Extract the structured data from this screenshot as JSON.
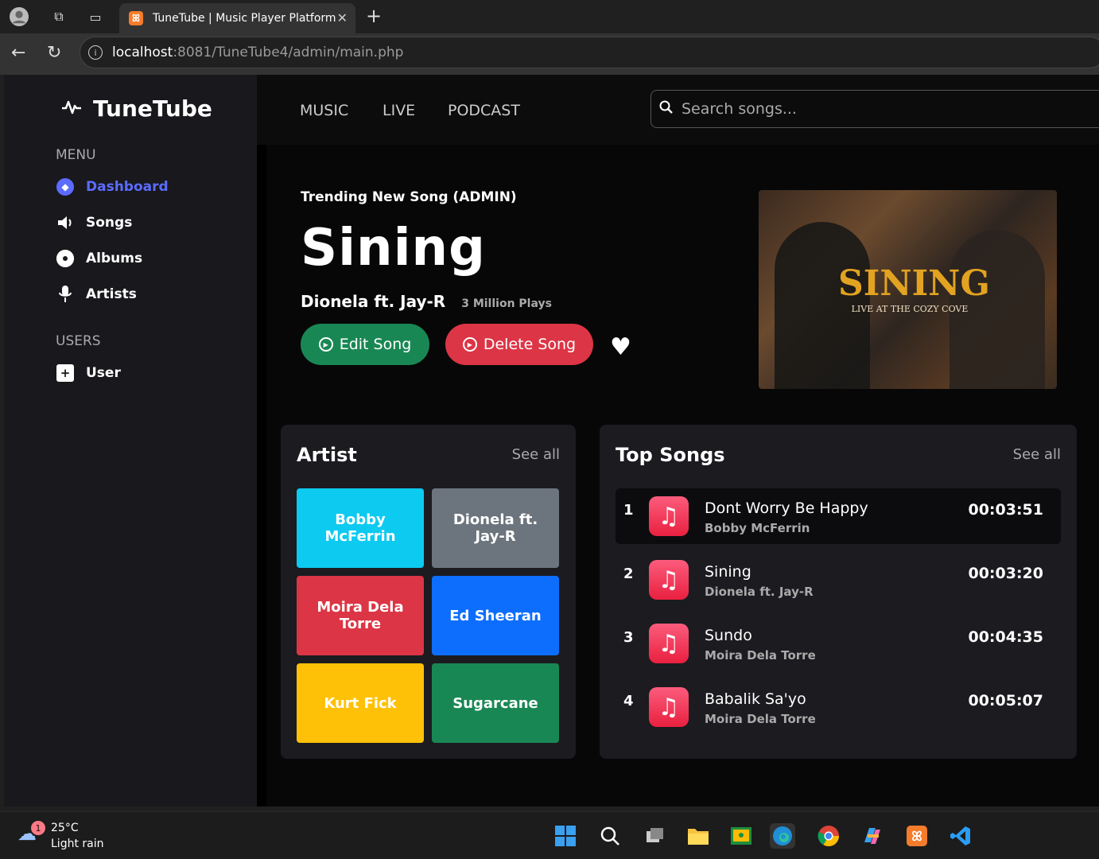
{
  "browser": {
    "tab_title": "TuneTube | Music Player Platform",
    "url_host": "localhost",
    "url_rest": ":8081/TuneTube4/admin/main.php"
  },
  "sidebar": {
    "brand": "TuneTube",
    "menu_title": "MENU",
    "menu": [
      {
        "label": "Dashboard",
        "icon": "dashboard-icon",
        "active": true
      },
      {
        "label": "Songs",
        "icon": "speaker-icon"
      },
      {
        "label": "Albums",
        "icon": "disc-icon"
      },
      {
        "label": "Artists",
        "icon": "mic-icon"
      }
    ],
    "users_title": "USERS",
    "users": [
      {
        "label": "User",
        "icon": "plus-square-icon"
      }
    ]
  },
  "topnav": {
    "links": [
      "MUSIC",
      "LIVE",
      "PODCAST"
    ],
    "search_placeholder": "Search songs..."
  },
  "hero": {
    "eyebrow": "Trending New Song (ADMIN)",
    "title": "Sining",
    "artist": "Dionela ft. Jay-R",
    "plays": "3 Million Plays",
    "edit_label": "Edit Song",
    "delete_label": "Delete Song",
    "cover_title": "SINING",
    "cover_subtitle": "LIVE AT THE COZY COVE"
  },
  "artist_panel": {
    "title": "Artist",
    "see_all": "See all",
    "artists": [
      {
        "name": "Bobby McFerrin",
        "color": "#0dcaf0"
      },
      {
        "name": "Dionela ft. Jay-R",
        "color": "#6c757d"
      },
      {
        "name": "Moira Dela Torre",
        "color": "#dc3545"
      },
      {
        "name": "Ed Sheeran",
        "color": "#0d6efd"
      },
      {
        "name": "Kurt Fick",
        "color": "#ffc107"
      },
      {
        "name": "Sugarcane",
        "color": "#198754"
      }
    ]
  },
  "songs_panel": {
    "title": "Top Songs",
    "see_all": "See all",
    "songs": [
      {
        "num": "1",
        "title": "Dont Worry Be Happy",
        "artist": "Bobby McFerrin",
        "duration": "00:03:51"
      },
      {
        "num": "2",
        "title": "Sining",
        "artist": "Dionela ft. Jay-R",
        "duration": "00:03:20"
      },
      {
        "num": "3",
        "title": "Sundo",
        "artist": "Moira Dela Torre",
        "duration": "00:04:35"
      },
      {
        "num": "4",
        "title": "Babalik Sa'yo",
        "artist": "Moira Dela Torre",
        "duration": "00:05:07"
      }
    ]
  },
  "taskbar": {
    "temp": "25°C",
    "weather": "Light rain",
    "badge": "1"
  }
}
